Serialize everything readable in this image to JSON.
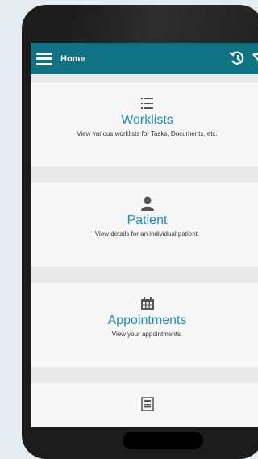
{
  "appbar": {
    "title": "Home",
    "menu_icon": "hamburger-icon",
    "history_icon": "history-icon",
    "filter_icon": "filter-icon",
    "color": "#0f7384"
  },
  "cards": [
    {
      "label": "Worklists",
      "description": "View various worklists for Tasks, Documents, etc.",
      "icon": "list-icon"
    },
    {
      "label": "Patient",
      "description": "View details for an individual patient.",
      "icon": "person-icon"
    },
    {
      "label": "Appointments",
      "description": "View your appointments.",
      "icon": "calendar-icon"
    },
    {
      "label": "",
      "description": "",
      "icon": "newspaper-icon"
    }
  ],
  "accent_color": "#1a8fc6"
}
